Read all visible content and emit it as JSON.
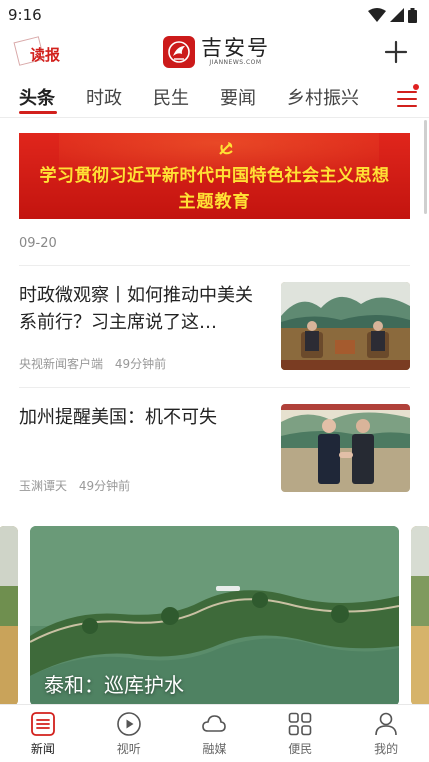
{
  "status_bar": {
    "time": "9:16",
    "icons": [
      "wifi-icon",
      "signal-icon",
      "battery-icon"
    ]
  },
  "header": {
    "dubao_label": "读报",
    "logo_name": "吉安号",
    "logo_sub": "JIANNEWS.COM",
    "add_icon": "plus-icon"
  },
  "tabs": [
    {
      "label": "头条",
      "active": true
    },
    {
      "label": "时政",
      "active": false
    },
    {
      "label": "民生",
      "active": false
    },
    {
      "label": "要闻",
      "active": false
    },
    {
      "label": "乡村振兴",
      "active": false
    }
  ],
  "banner": {
    "line1": "学习贯彻习近平新时代中国特色社会主义思想",
    "line2": "主题教育"
  },
  "date": "09-20",
  "news": [
    {
      "title": "时政微观察丨如何推动中美关系前行？习主席说了这…",
      "source": "央视新闻客户端",
      "time": "49分钟前"
    },
    {
      "title": "加州提醒美国：机不可失",
      "source": "玉渊谭天",
      "time": "49分钟前"
    }
  ],
  "carousel": {
    "caption": "泰和：巡库护水"
  },
  "bottom_nav": [
    {
      "label": "新闻",
      "icon": "news-list-icon",
      "active": true
    },
    {
      "label": "视听",
      "icon": "play-circle-icon",
      "active": false
    },
    {
      "label": "融媒",
      "icon": "cloud-icon",
      "active": false
    },
    {
      "label": "便民",
      "icon": "grid-apps-icon",
      "active": false
    },
    {
      "label": "我的",
      "icon": "person-icon",
      "active": false
    }
  ],
  "colors": {
    "accent": "#d2201c",
    "banner_text": "#ffe135"
  }
}
